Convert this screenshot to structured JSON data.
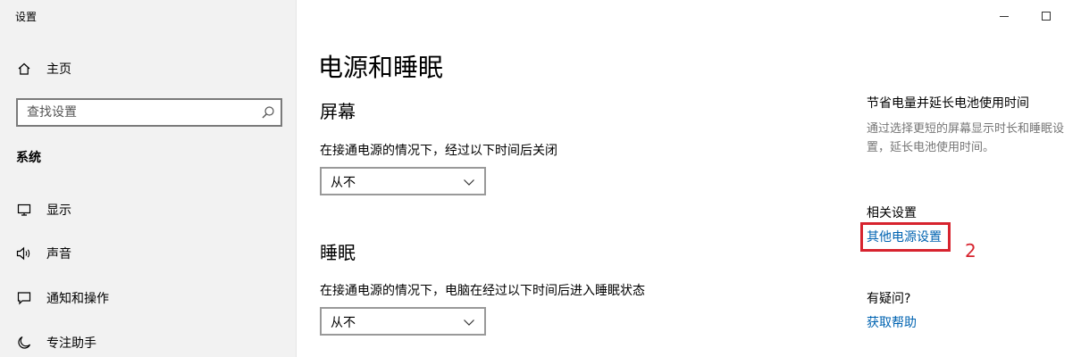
{
  "window": {
    "title": "设置"
  },
  "sidebar": {
    "home_label": "主页",
    "search": {
      "placeholder": "查找设置",
      "value": ""
    },
    "section_label": "系统",
    "items": [
      {
        "label": "显示",
        "icon": "monitor-icon"
      },
      {
        "label": "声音",
        "icon": "speaker-icon"
      },
      {
        "label": "通知和操作",
        "icon": "notification-icon"
      },
      {
        "label": "专注助手",
        "icon": "moon-icon"
      }
    ]
  },
  "main": {
    "title": "电源和睡眠",
    "screen": {
      "heading": "屏幕",
      "description": "在接通电源的情况下，经过以下时间后关闭",
      "selected": "从不"
    },
    "sleep": {
      "heading": "睡眠",
      "description": "在接通电源的情况下，电脑在经过以下时间后进入睡眠状态",
      "selected": "从不"
    }
  },
  "right_panel": {
    "battery_tip": {
      "heading": "节省电量并延长电池使用时间",
      "text_line1": "通过选择更短的屏幕显示时长和睡眠设",
      "text_line2": "置，延长电池使用时间。"
    },
    "related": {
      "heading": "相关设置",
      "link": "其他电源设置"
    },
    "help": {
      "heading": "有疑问?",
      "link": "获取帮助"
    }
  },
  "annotation": {
    "number": "2",
    "color": "#d7232e"
  },
  "colors": {
    "sidebar_bg": "#f2f2f2",
    "link": "#0063b1",
    "muted_text": "#767676"
  }
}
